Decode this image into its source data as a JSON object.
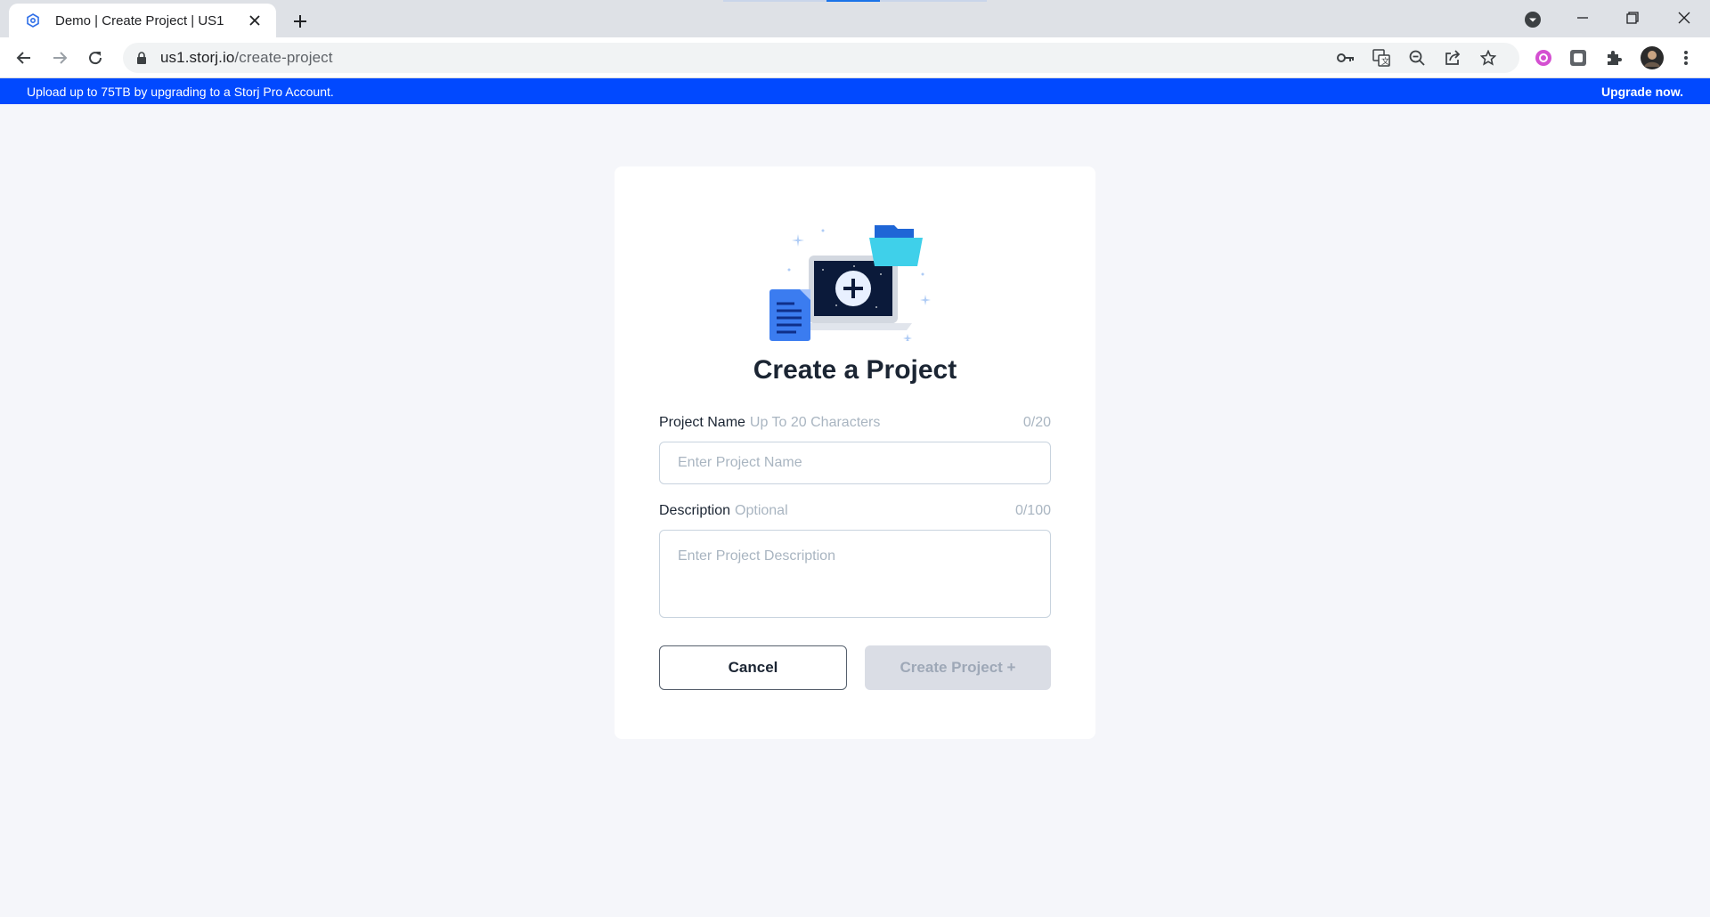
{
  "browser": {
    "tab_title": "Demo | Create Project | US1",
    "url_host": "us1.storj.io",
    "url_path": "/create-project",
    "icons": [
      "storj-favicon-icon",
      "close-icon",
      "plus-icon",
      "tab-search-icon",
      "minimize-icon",
      "restore-icon",
      "window-close-icon",
      "back-icon",
      "forward-icon",
      "reload-icon",
      "lock-icon",
      "key-icon",
      "translate-icon",
      "zoom-out-icon",
      "share-icon",
      "star-icon",
      "extension-pink-icon",
      "extension-square-icon",
      "puzzle-icon",
      "profile-avatar",
      "kebab-menu-icon"
    ]
  },
  "banner": {
    "message": "Upload up to 75TB by upgrading to a Storj Pro Account.",
    "link": "Upgrade now."
  },
  "form": {
    "title": "Create a Project",
    "name": {
      "label": "Project Name",
      "hint": "Up To 20 Characters",
      "counter": "0/20",
      "placeholder": "Enter Project Name"
    },
    "description": {
      "label": "Description",
      "hint": "Optional",
      "counter": "0/100",
      "placeholder": "Enter Project Description"
    },
    "cancel_label": "Cancel",
    "create_label": "Create Project +"
  },
  "colors": {
    "banner": "#0149ff",
    "page_bg": "#f5f6fa",
    "title": "#1b2533",
    "hint": "#a9b5c1",
    "disabled_button": "#dadde5"
  }
}
